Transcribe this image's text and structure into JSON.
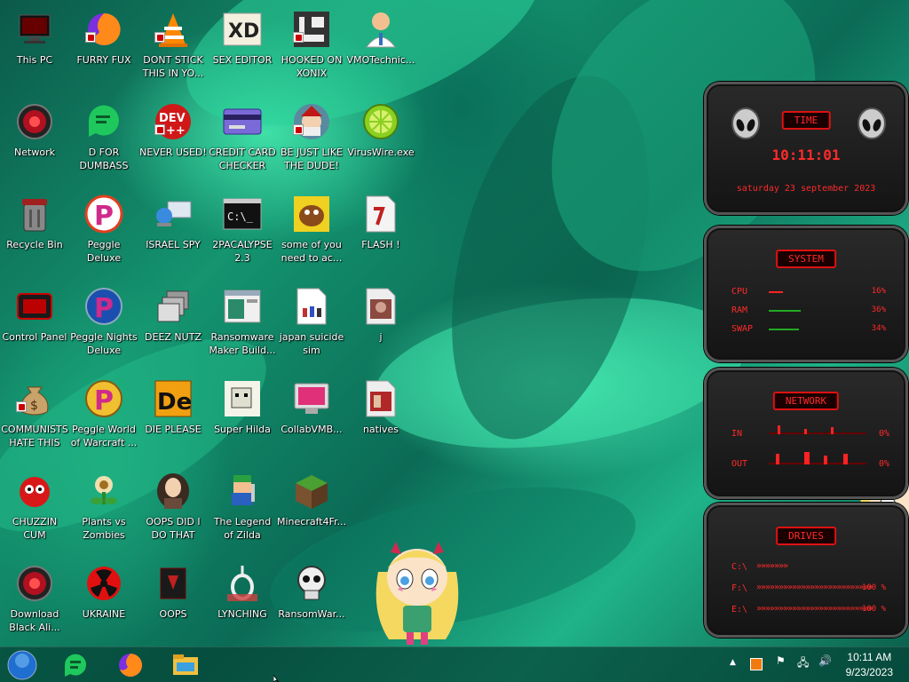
{
  "desktop": {
    "icons": [
      {
        "label": "This PC"
      },
      {
        "label": "FURRY FUX"
      },
      {
        "label": "DONT STICK THIS IN YO..."
      },
      {
        "label": "SEX EDITOR"
      },
      {
        "label": "HOOKED ON XONIX"
      },
      {
        "label": "VMOTechnic..."
      },
      {
        "label": "Network"
      },
      {
        "label": "D FOR DUMBASS"
      },
      {
        "label": "NEVER USED!"
      },
      {
        "label": "CREDIT CARD CHECKER"
      },
      {
        "label": "BE JUST LIKE THE DUDE!"
      },
      {
        "label": "VirusWire.exe"
      },
      {
        "label": "Recycle Bin"
      },
      {
        "label": "Peggle Deluxe"
      },
      {
        "label": "ISRAEL SPY"
      },
      {
        "label": "2PACALYPSE 2.3"
      },
      {
        "label": "some of you need to ac..."
      },
      {
        "label": "FLASH !"
      },
      {
        "label": "Control Panel"
      },
      {
        "label": "Peggle Nights Deluxe"
      },
      {
        "label": "DEEZ NUTZ"
      },
      {
        "label": "Ransomware Maker Build..."
      },
      {
        "label": "japan suicide sim"
      },
      {
        "label": "j"
      },
      {
        "label": "COMMUNISTS HATE THIS G..."
      },
      {
        "label": "Peggle World of Warcraft ..."
      },
      {
        "label": "DIE PLEASE"
      },
      {
        "label": "Super Hilda"
      },
      {
        "label": "CollabVMB..."
      },
      {
        "label": "natives"
      },
      {
        "label": "CHUZZIN CUM"
      },
      {
        "label": "Plants vs Zombies"
      },
      {
        "label": "OOPS DID I DO THAT"
      },
      {
        "label": "The Legend of Zilda"
      },
      {
        "label": "Minecraft4Fr..."
      },
      {
        "label": "Download Black Ali..."
      },
      {
        "label": "UKRAINE"
      },
      {
        "label": "OOPS"
      },
      {
        "label": "LYNCHING"
      },
      {
        "label": "RansomWar..."
      }
    ],
    "dev_badge": "DEV",
    "dev_plus": "++",
    "xd_badge": "XD",
    "peggle_p": "P",
    "die_badge": "De",
    "cmd_text": "C:\\_",
    "dollar": "$"
  },
  "widgets": {
    "time": {
      "title": "TIME",
      "clock": "10:11:01",
      "date": "saturday 23 september 2023"
    },
    "system": {
      "title": "SYSTEM",
      "rows": [
        {
          "label": "CPU",
          "value": "16%",
          "level": 0.16
        },
        {
          "label": "RAM",
          "value": "36%",
          "level": 0.36
        },
        {
          "label": "SWAP",
          "value": "34%",
          "level": 0.34
        }
      ]
    },
    "network": {
      "title": "NETWORK",
      "rows": [
        {
          "label": "IN",
          "value": "0%"
        },
        {
          "label": "OUT",
          "value": "0%"
        }
      ]
    },
    "drives": {
      "title": "DRIVES",
      "rows": [
        {
          "label": "C:\\",
          "value": ""
        },
        {
          "label": "F:\\",
          "value": "100 %"
        },
        {
          "label": "E:\\",
          "value": "100 %"
        }
      ]
    }
  },
  "taskbar": {
    "apps": [
      "start-orb-icon",
      "chat-app-icon",
      "firefox-icon",
      "file-explorer-icon"
    ],
    "tray": {
      "chevron": "▲",
      "flag": "⚑",
      "network": "🖧",
      "volume": "🔊"
    },
    "time": "10:11 AM",
    "date": "9/23/2023"
  },
  "colors": {
    "widget_red": "#ff2a2a",
    "wallpaper_green": "#14946f",
    "taskbar_bg": "#064638"
  }
}
